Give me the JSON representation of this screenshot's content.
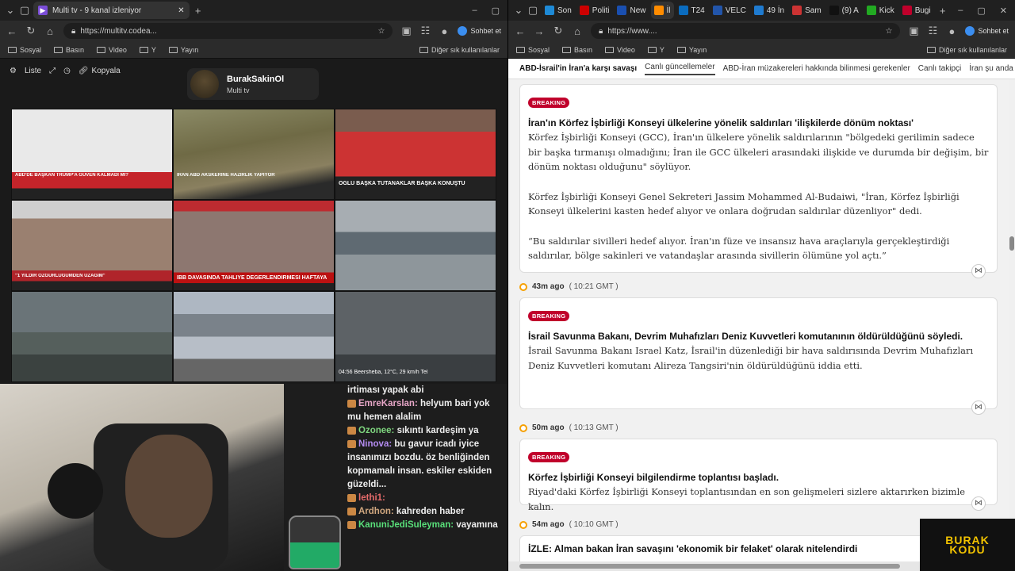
{
  "left_window": {
    "tab_title": "Multi tv - 9 kanal izleniyor",
    "url": "https://multitv.codea...",
    "chat_button": "Sohbet et",
    "bookmarks": [
      "Sosyal",
      "Basın",
      "Video",
      "Y",
      "Yayın"
    ],
    "bookmarks_other": "Diğer sık kullanılanlar"
  },
  "multitv": {
    "toolbar": {
      "list": "Liste",
      "copy": "Kopyala"
    },
    "profile": {
      "name": "BurakSakinOl",
      "subtitle": "Multi tv"
    },
    "captions": [
      "ABD'DE BAŞKAN TRUMP'A GÜVEN KALMADI MI?",
      "İRAN ABD AKSKERİNE HAZIRLIK YAPIYOR",
      "OĞLU BAŞKA TUTANAKLAR BAŞKA KONUŞTU",
      "\"1 YILDIR ÖZGÜRLÜĞÜMDEN UZAĞIM\"",
      "İBB DAVASINDA TAHLİYE DEĞERLENDİRMESİ HAFTAYA",
      "",
      "",
      "",
      "04:56  Beersheba, 12°C, 29 km/h  Tel"
    ]
  },
  "chat": {
    "messages": [
      {
        "user": "",
        "text": "irtiması yapak abi",
        "color": "#eeeeee"
      },
      {
        "user": "EmreKarslan:",
        "text": "helyum bari yok mu hemen alalim",
        "color": "#e8a7c8"
      },
      {
        "user": "Ozonee:",
        "text": "sıkıntı kardeşim ya",
        "color": "#7fd67f"
      },
      {
        "user": "Ninova:",
        "text": "bu gavur icadı iyice insanımızı bozdu. öz benliğinden kopmamalı insan. eskiler eskiden güzeldi...",
        "color": "#b48cf2"
      },
      {
        "user": "lethi1:",
        "text": "",
        "color": "#e86b6b"
      },
      {
        "user": "Ardhon:",
        "text": "kahreden haber",
        "color": "#d0a77f"
      },
      {
        "user": "KanuniJediSuleyman:",
        "text": "vayamına",
        "color": "#59e07a"
      }
    ]
  },
  "right_window": {
    "tabs": [
      "Son",
      "Politi",
      "New",
      "İl",
      "T24",
      "VELC",
      "49 İn",
      "Sam",
      "(9) A",
      "Kick",
      "Bugi"
    ],
    "url": "https://www....",
    "chat_button": "Sohbet et",
    "bookmarks": [
      "Sosyal",
      "Basın",
      "Video",
      "Y",
      "Yayın"
    ],
    "bookmarks_other": "Diğer sık kullanılanlar",
    "nav": {
      "title": "ABD-İsrail'in İran'a karşı savaşı",
      "items": [
        "Canlı güncellemeler",
        "ABD-İran müzakereleri hakkında bilinmesi gerekenler",
        "Canlı takipçi",
        "İran şu anda dah"
      ]
    },
    "badge_label": "BREAKING",
    "posts": [
      {
        "headline": "İran'ın Körfez İşbirliği Konseyi ülkelerine yönelik saldırıları 'ilişkilerde dönüm noktası'",
        "paragraphs": [
          "Körfez İşbirliği Konseyi (GCC), İran'ın ülkelere yönelik saldırılarının \"bölgedeki gerilimin sadece bir başka tırmanışı olmadığını; İran ile GCC ülkeleri arasındaki ilişkide ve durumda bir değişim, bir dönüm noktası olduğunu\" söylüyor.",
          "Körfez İşbirliği Konseyi Genel Sekreteri Jassim Mohammed Al-Budaiwi, \"İran, Körfez İşbirliği Konseyi ülkelerini kasten hedef alıyor ve onlara doğrudan saldırılar düzenliyor\" dedi.",
          "“Bu saldırılar sivilleri hedef alıyor. İran'ın füze ve insansız hava araçlarıyla gerçekleştirdiği saldırılar, bölge sakinleri ve vatandaşlar arasında sivillerin ölümüne yol açtı.”"
        ]
      },
      {
        "time": "43m ago",
        "gmt": "( 10:21 GMT )",
        "headline": "İsrail Savunma Bakanı, Devrim Muhafızları Deniz Kuvvetleri komutanının öldürüldüğünü söyledi.",
        "paragraphs": [
          "İsrail Savunma Bakanı Israel Katz, İsrail'in düzenlediği bir hava saldırısında Devrim Muhafızları Deniz Kuvvetleri komutanı Alireza Tangsiri'nin öldürüldüğünü iddia etti."
        ]
      },
      {
        "time": "50m ago",
        "gmt": "( 10:13 GMT )",
        "headline": "Körfez İşbirliği Konseyi bilgilendirme toplantısı başladı.",
        "paragraphs": [
          "Riyad'daki Körfez İşbirliği Konseyi toplantısından en son gelişmeleri sizlere aktarırken bizimle kalın."
        ]
      },
      {
        "time": "54m ago",
        "gmt": "( 10:10 GMT )",
        "headline": "İZLE: Alman bakan İran savaşını 'ekonomik bir felaket' olarak nitelendirdi"
      }
    ]
  },
  "overlay_logo": {
    "line1": "BURAK",
    "line2": "KODU"
  },
  "colors": {
    "breaking": "#c0002b",
    "timeline_dot": "#f6a000",
    "logo": "#f2c300"
  }
}
